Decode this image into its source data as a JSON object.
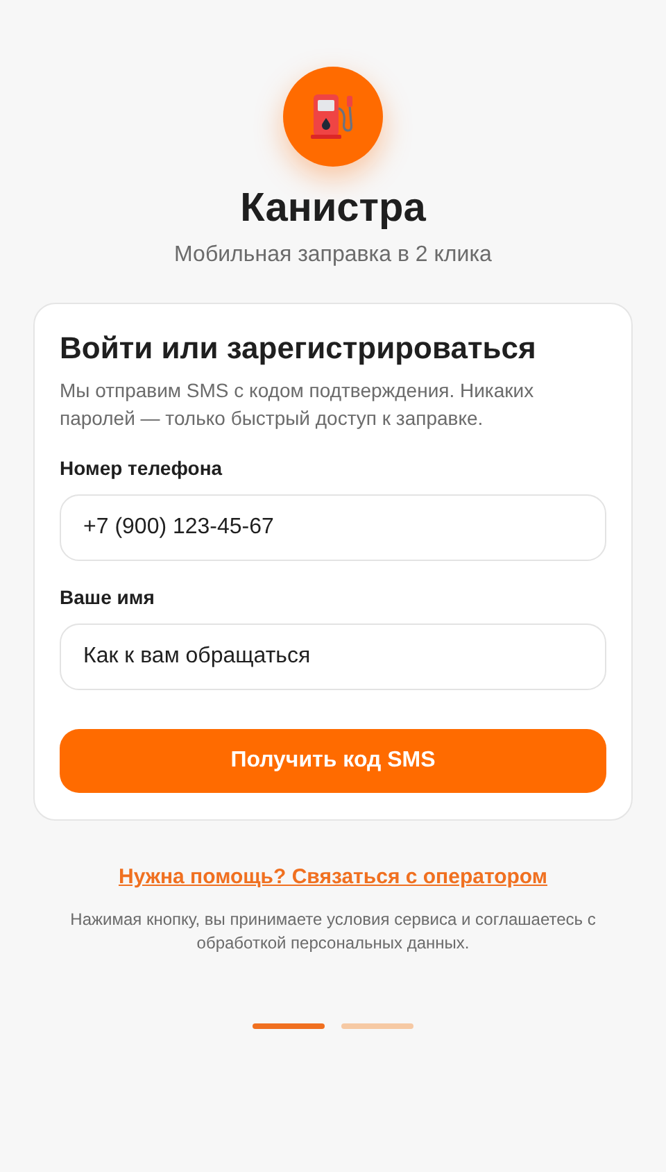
{
  "app": {
    "title": "Канистра",
    "subtitle": "Мобильная заправка в 2 клика"
  },
  "card": {
    "heading": "Войти или зарегистрироваться",
    "description": "Мы отправим SMS с кодом подтверждения. Никаких паролей — только быстрый доступ к заправке.",
    "fields": [
      {
        "label": "Номер телефона",
        "value": "+7 (900) 123-45-67"
      },
      {
        "label": "Ваше имя",
        "value": "Как к вам обращаться"
      }
    ],
    "submit": "Получить код SMS"
  },
  "help_link": "Нужна помощь? Связаться с оператором",
  "disclaimer": "Нажимая кнопку, вы принимаете условия сервиса и соглашаетесь с обработкой персональных данных.",
  "pages": [
    {
      "selected": true
    },
    {
      "selected": false
    }
  ]
}
